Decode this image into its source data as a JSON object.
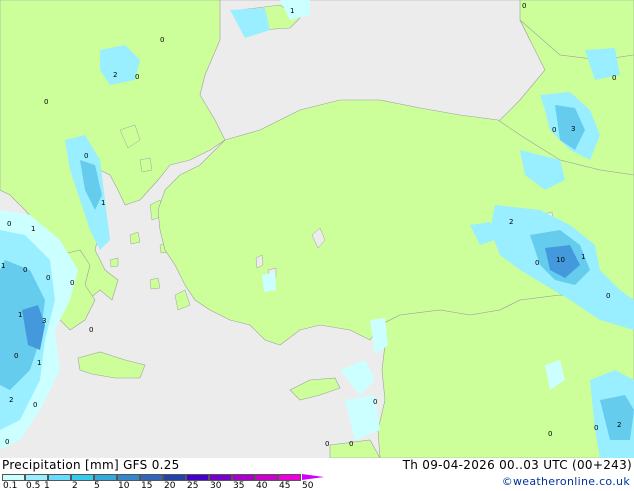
{
  "colors": {
    "sea": "#ececec",
    "land": "#ccff99",
    "precip_light": "#ccffff",
    "precip_mid": "#99eeff",
    "precip_strong": "#66ccee",
    "precip_heavy": "#4499dd",
    "border": "#a0a0a0"
  },
  "map": {
    "labels": [
      "1",
      "0",
      "2",
      "0",
      "0",
      "0",
      "3",
      "0",
      "0",
      "0",
      "1",
      "0",
      "2",
      "1",
      "10",
      "1",
      "0",
      "0",
      "1",
      "0",
      "0",
      "1",
      "0",
      "3",
      "0",
      "0",
      "1",
      "0",
      "2",
      "0",
      "0",
      "0",
      "0",
      "0",
      "2",
      "0"
    ]
  },
  "footer": {
    "left_title": "Precipitation [mm]  GFS 0.25",
    "right_title": "Th 09-04-2026 00..03 UTC (00+243)",
    "credit": "©weatheronline.co.uk"
  },
  "legend": {
    "ticks": [
      "0.1",
      "0.5",
      "1",
      "2",
      "5",
      "10",
      "15",
      "20",
      "25",
      "30",
      "35",
      "40",
      "45",
      "50"
    ],
    "colors": [
      "#ccffff",
      "#99eeff",
      "#66ddff",
      "#33ccee",
      "#33aadd",
      "#3388cc",
      "#3366bb",
      "#2244aa",
      "#4400cc",
      "#7700cc",
      "#aa00cc",
      "#cc00cc",
      "#ee00dd"
    ]
  }
}
